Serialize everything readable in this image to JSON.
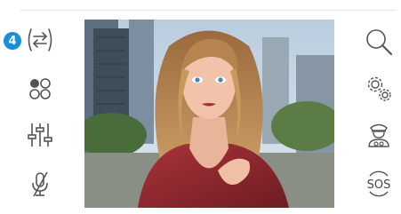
{
  "notification": {
    "count": "4"
  },
  "left_toolbar": {
    "items": [
      {
        "icon": "call-transfer-icon"
      },
      {
        "icon": "cameras-grid-icon"
      },
      {
        "icon": "sliders-settings-icon"
      },
      {
        "icon": "microphone-muted-icon"
      }
    ]
  },
  "right_toolbar": {
    "items": [
      {
        "icon": "search-zoom-icon"
      },
      {
        "icon": "gears-settings-icon"
      },
      {
        "icon": "concierge-icon"
      },
      {
        "icon": "sos-icon",
        "label": "SOS"
      }
    ]
  },
  "video": {
    "state": "live camera feed"
  },
  "colors": {
    "accent": "#1a8ed8",
    "icon": "#555555",
    "background": "#ffffff"
  }
}
